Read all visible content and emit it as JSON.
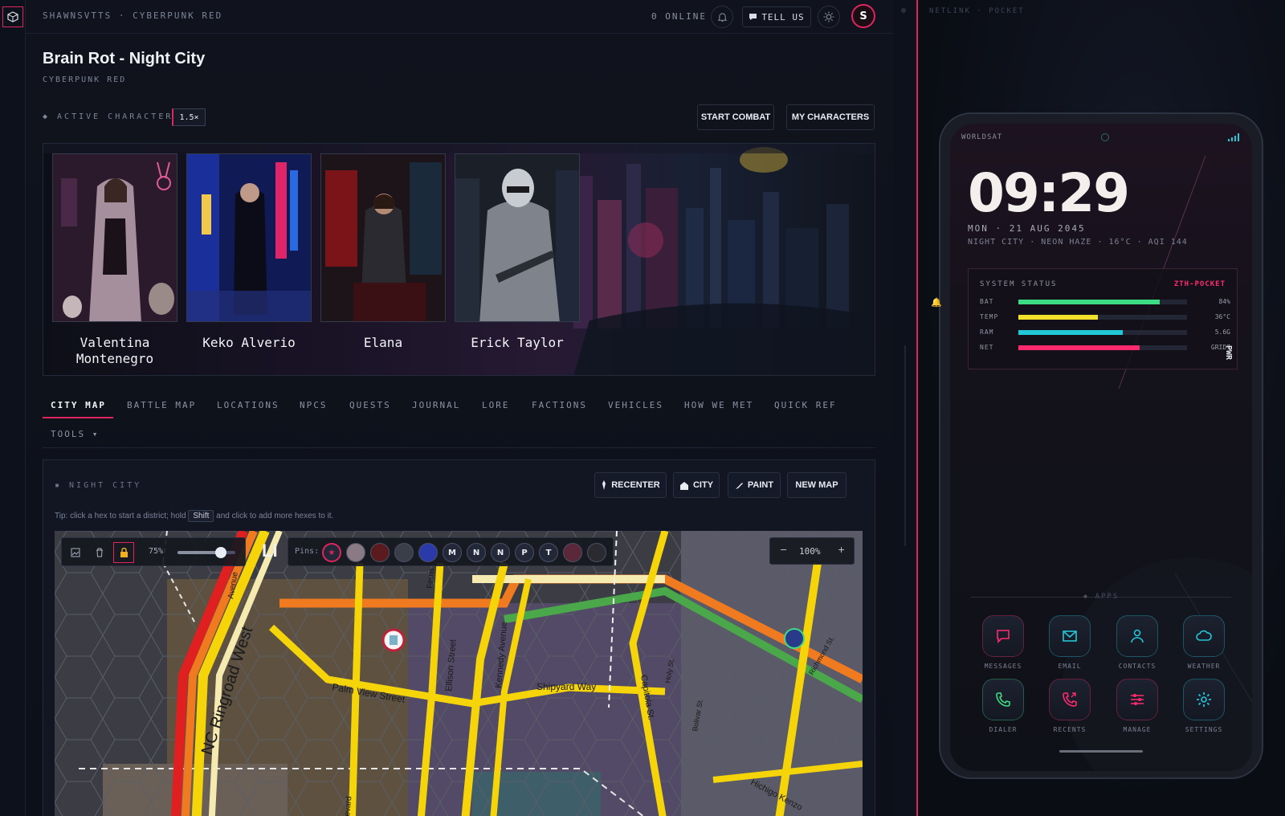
{
  "app": {
    "breadcrumb": "SHAWNSVTTS · CYBERPUNK RED",
    "online": "0 ONLINE",
    "tell_us": "TELL US",
    "avatar": "S"
  },
  "campaign": {
    "title": "Brain Rot - Night City",
    "system": "CYBERPUNK RED"
  },
  "active": {
    "label": "◆ ACTIVE CHARACTERS",
    "zoom": "1.5×",
    "start_combat": "START COMBAT",
    "my_characters": "MY CHARACTERS"
  },
  "characters": [
    {
      "name": "Valentina Montenegro",
      "accent": "#c79aa8"
    },
    {
      "name": "Keko Alverio",
      "accent": "#2f5fe0"
    },
    {
      "name": "Elana",
      "accent": "#c0262e"
    },
    {
      "name": "Erick Taylor",
      "accent": "#8a8f98"
    }
  ],
  "tabs": [
    "CITY MAP",
    "BATTLE MAP",
    "LOCATIONS",
    "NPCS",
    "QUESTS",
    "JOURNAL",
    "LORE",
    "FACTIONS",
    "VEHICLES",
    "HOW WE MET",
    "QUICK REF",
    "TOOLS ▾"
  ],
  "active_tab": "CITY MAP",
  "panel": {
    "label": "▪ NIGHT CITY",
    "recenter": "RECENTER",
    "city": "CITY",
    "paint": "PAINT",
    "new_map": "NEW MAP",
    "tip_before": "Tip: click a hex to start a district; hold",
    "tip_key": "Shift",
    "tip_after": "and click to add more hexes to it."
  },
  "map": {
    "opacity": "75%",
    "opacity_value": 0.75,
    "pins_label": "Pins:",
    "pins": [
      "M",
      "N",
      "N",
      "P",
      "T"
    ],
    "zoom": "100%",
    "zoom_minus": "−",
    "zoom_plus": "+",
    "overlay_text": "LI",
    "streets": [
      "NC Ringroad West",
      "Palm View Street",
      "Shipyard Way",
      "Ellison Street",
      "Kennedy Avenue",
      "Capitola St.",
      "Ferris",
      "Avenue",
      "Holy St.",
      "Richmond St.",
      "Hichigo Kenzo",
      "Bulevard",
      "Bolivar St."
    ]
  },
  "right": {
    "header": "NETLINK · POCKET",
    "carrier": "WORLDSAT",
    "time": "09:29",
    "date": "MON · 21 AUG 2045",
    "location": "NIGHT CITY · NEON HAZE · 16°C · AQI 144",
    "status_title": "SYSTEM STATUS",
    "status_brand": "ZTH-POCKET",
    "metrics": [
      {
        "label": "BAT",
        "value": "84%",
        "level": 0.84,
        "color": "#3ddc84"
      },
      {
        "label": "TEMP",
        "value": "36°C",
        "level": 0.47,
        "color": "#f2e02a"
      },
      {
        "label": "RAM",
        "value": "5.6G",
        "level": 0.62,
        "color": "#22c7d8"
      },
      {
        "label": "NET",
        "value": "GRID7",
        "level": 0.72,
        "color": "#ff2a6d"
      }
    ],
    "apps_label": "◆ APPS",
    "apps": [
      {
        "name": "MESSAGES",
        "icon": "chat-icon",
        "color": "#ff2a6d"
      },
      {
        "name": "EMAIL",
        "icon": "mail-icon",
        "color": "#22c7d8"
      },
      {
        "name": "CONTACTS",
        "icon": "person-icon",
        "color": "#22c7d8"
      },
      {
        "name": "WEATHER",
        "icon": "cloud-icon",
        "color": "#22c7d8"
      },
      {
        "name": "DIALER",
        "icon": "phone-icon",
        "color": "#3ddc84"
      },
      {
        "name": "RECENTS",
        "icon": "phone-recent-icon",
        "color": "#ff2a6d"
      },
      {
        "name": "MANAGE",
        "icon": "sliders-icon",
        "color": "#ff2a6d"
      },
      {
        "name": "SETTINGS",
        "icon": "gear-icon",
        "color": "#22c7d8"
      }
    ],
    "pwr": "PWR"
  },
  "colors": {
    "accent": "#e0245e",
    "bg": "#0b0e16",
    "road_yellow": "#f5d40a"
  }
}
